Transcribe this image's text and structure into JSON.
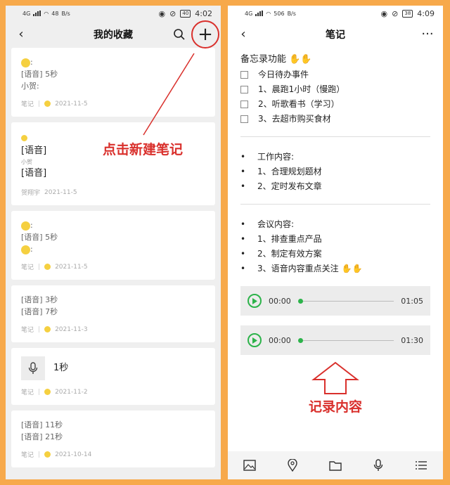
{
  "left": {
    "status": {
      "net": "4G",
      "speed": "48",
      "speed_unit": "B/s",
      "battery": "40",
      "time": "4:02"
    },
    "nav": {
      "title": "我的收藏"
    },
    "annotation": "点击新建笔记",
    "cards": [
      {
        "lines": [
          ":",
          "[语音] 5秒",
          "小贺:"
        ],
        "meta_type": "笔记",
        "date": "2021-11-5"
      },
      {
        "name_small": "小贺",
        "voice_a": "[语音]",
        "voice_b": "[语音]",
        "author": "贺翔宇",
        "date": "2021-11-5"
      },
      {
        "lines": [
          ":",
          "[语音] 5秒",
          ":"
        ],
        "meta_type": "笔记",
        "date": "2021-11-5"
      },
      {
        "lines": [
          "[语音] 3秒",
          "[语音] 7秒"
        ],
        "meta_type": "笔记",
        "date": "2021-11-3"
      },
      {
        "voice_len": "1秒",
        "meta_type": "笔记",
        "date": "2021-11-2"
      },
      {
        "lines": [
          "[语音] 11秒",
          "[语音] 21秒"
        ],
        "meta_type": "笔记",
        "date": "2021-10-14"
      }
    ]
  },
  "right": {
    "status": {
      "net": "4G",
      "speed": "506",
      "speed_unit": "B/s",
      "battery": "38",
      "time": "4:09"
    },
    "nav": {
      "title": "笔记",
      "more": "···"
    },
    "memo_title": "备忘录功能",
    "todo_title": "今日待办事件",
    "todos": [
      "1、晨跑1小时（慢跑）",
      "2、听歌看书（学习）",
      "3、去超市购买食材"
    ],
    "work_title": "工作内容:",
    "work_items": [
      "1、合理规划题材",
      "2、定时发布文章"
    ],
    "meeting_title": "会议内容:",
    "meeting_items": [
      "1、排查重点产品",
      "2、制定有效方案",
      "3、语音内容重点关注"
    ],
    "audios": [
      {
        "start": "00:00",
        "end": "01:05"
      },
      {
        "start": "00:00",
        "end": "01:30"
      }
    ],
    "annotation": "记录内容",
    "bullet": "•"
  }
}
